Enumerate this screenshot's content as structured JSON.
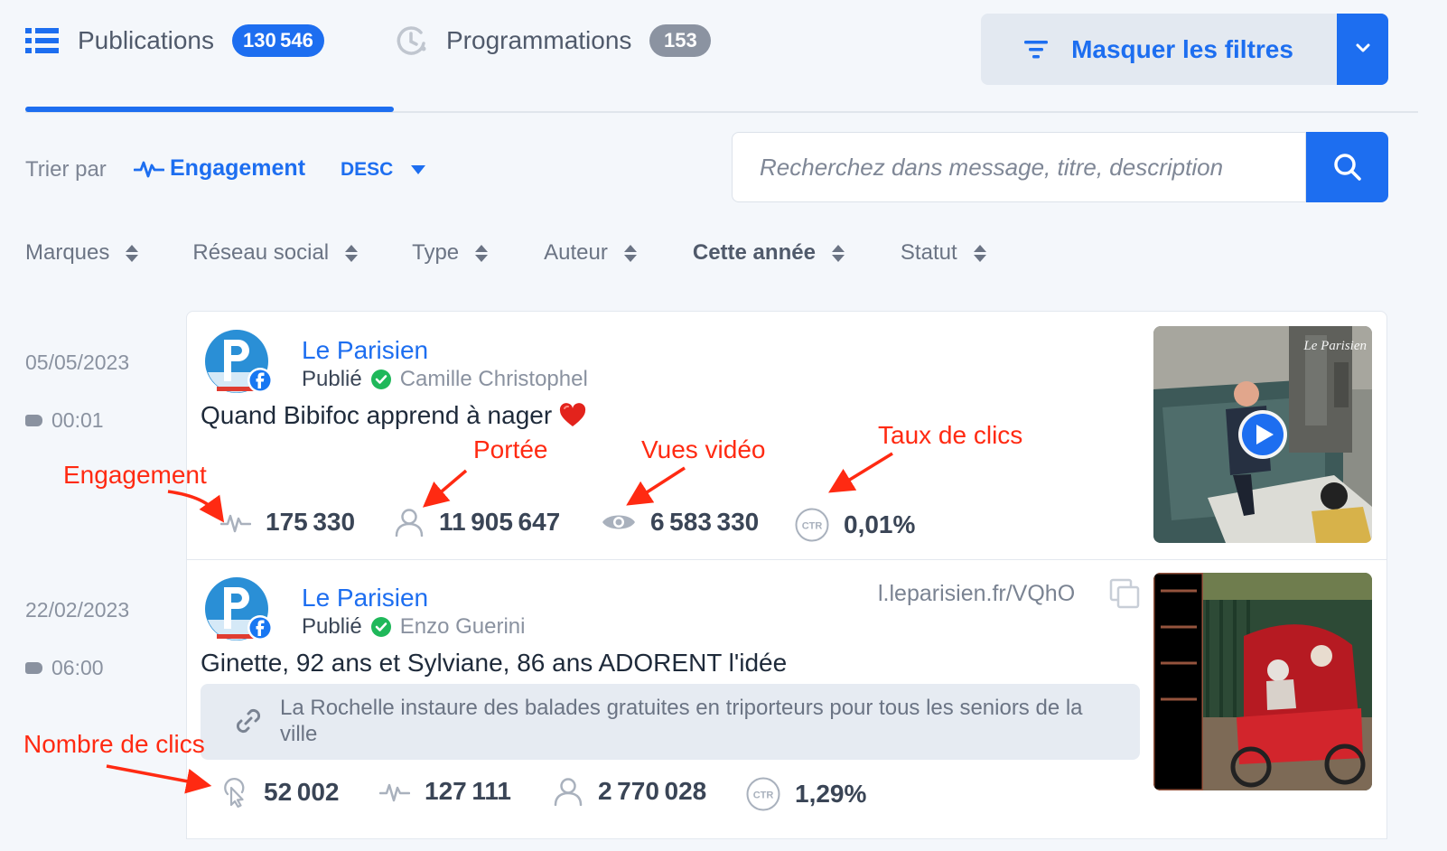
{
  "colors": {
    "accent": "#1d6ef0",
    "annotation": "#ff2a12",
    "success": "#1fb85a"
  },
  "tabs": [
    {
      "label": "Publications",
      "count": "130546",
      "icon": "list-icon",
      "active": true
    },
    {
      "label": "Programmations",
      "count": "153",
      "icon": "clock-schedule-icon",
      "active": false
    }
  ],
  "filter_toggle": {
    "label": "Masquer les filtres"
  },
  "sort": {
    "label": "Trier par",
    "field": "Engagement",
    "direction": "DESC"
  },
  "search": {
    "placeholder": "Recherchez dans message, titre, description"
  },
  "filters": [
    "Marques",
    "Réseau social",
    "Type",
    "Auteur",
    "Cette année",
    "Statut"
  ],
  "posts": [
    {
      "date": "05/05/2023",
      "time": "00:01",
      "brand": "Le Parisien",
      "status": "Publié",
      "author": "Camille Christophel",
      "message": "Quand Bibifoc apprend à nager",
      "metrics": [
        {
          "icon": "engagement-icon",
          "value": "175330"
        },
        {
          "icon": "reach-icon",
          "value": "11905647"
        },
        {
          "icon": "video-views-icon",
          "value": "6583330"
        },
        {
          "icon": "ctr-icon",
          "value": "0,01%"
        }
      ]
    },
    {
      "date": "22/02/2023",
      "time": "06:00",
      "brand": "Le Parisien",
      "status": "Publié",
      "author": "Enzo Guerini",
      "short_link": "l.leparisien.fr/VQhO",
      "message": "Ginette, 92 ans et Sylviane, 86 ans ADORENT l'idée",
      "link_title": "La Rochelle instaure des balades gratuites en triporteurs pour tous les seniors de la ville",
      "metrics": [
        {
          "icon": "clicks-icon",
          "value": "52002"
        },
        {
          "icon": "engagement-icon",
          "value": "127111"
        },
        {
          "icon": "reach-icon",
          "value": "2770028"
        },
        {
          "icon": "ctr-icon",
          "value": "1,29%"
        }
      ]
    }
  ],
  "thumbnail_watermark": "Le Parisien",
  "annotations": {
    "engagement": "Engagement",
    "reach": "Portée",
    "video_views": "Vues vidéo",
    "ctr": "Taux de clics",
    "clicks": "Nombre de clics"
  }
}
